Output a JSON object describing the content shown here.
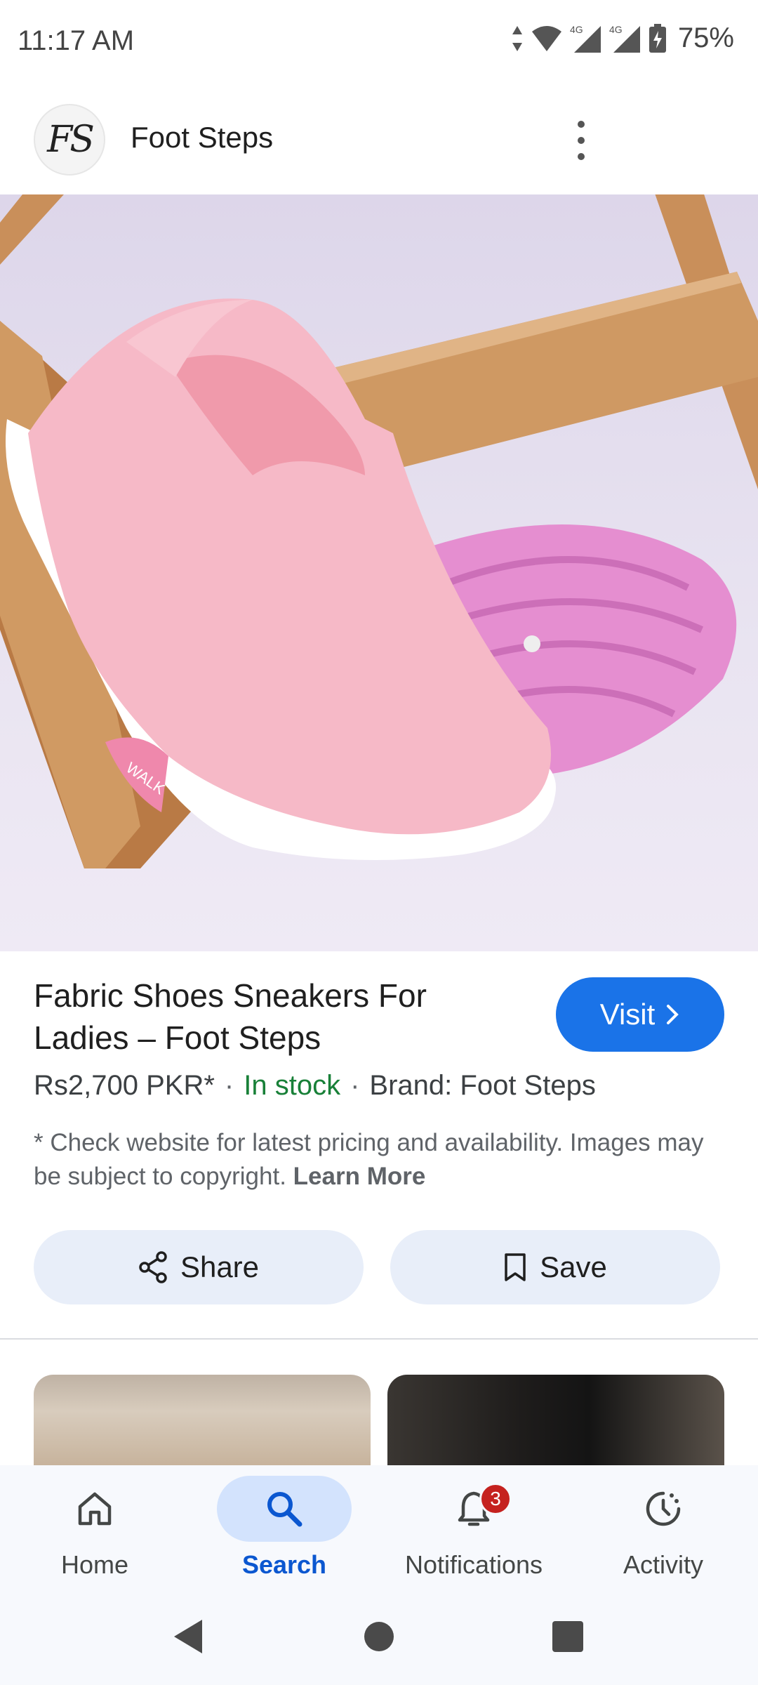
{
  "status_bar": {
    "time": "11:17 AM",
    "battery": "75%",
    "icons": [
      "data-arrows-icon",
      "wifi-icon",
      "signal-4g-icon",
      "signal-4g-icon",
      "battery-charging-icon"
    ],
    "network_labels": [
      "4G",
      "4G"
    ]
  },
  "header": {
    "logo_text": "FS",
    "merchant_name": "Foot Steps",
    "more_icon": "more-vert-icon"
  },
  "product": {
    "image_label": "WALK",
    "title": "Fabric Shoes Sneakers For Ladies – Foot Steps",
    "visit_label": "Visit",
    "price": "Rs2,700 PKR*",
    "stock": "In stock",
    "brand": "Brand: Foot Steps",
    "separator": "·",
    "disclaimer": "* Check website for latest pricing and availability. Images may be subject to copyright.",
    "learn_more": "Learn More"
  },
  "actions": {
    "share_label": "Share",
    "save_label": "Save"
  },
  "bottom_nav": {
    "items": [
      {
        "label": "Home",
        "icon": "home-icon",
        "active": false
      },
      {
        "label": "Search",
        "icon": "search-icon",
        "active": true
      },
      {
        "label": "Notifications",
        "icon": "bell-icon",
        "active": false,
        "badge": "3"
      },
      {
        "label": "Activity",
        "icon": "activity-icon",
        "active": false
      }
    ]
  },
  "colors": {
    "accent": "#1a73e8",
    "in_stock": "#188038",
    "badge": "#c5221f",
    "nav_active": "#0b57d0",
    "action_bg": "#e8eef9"
  }
}
